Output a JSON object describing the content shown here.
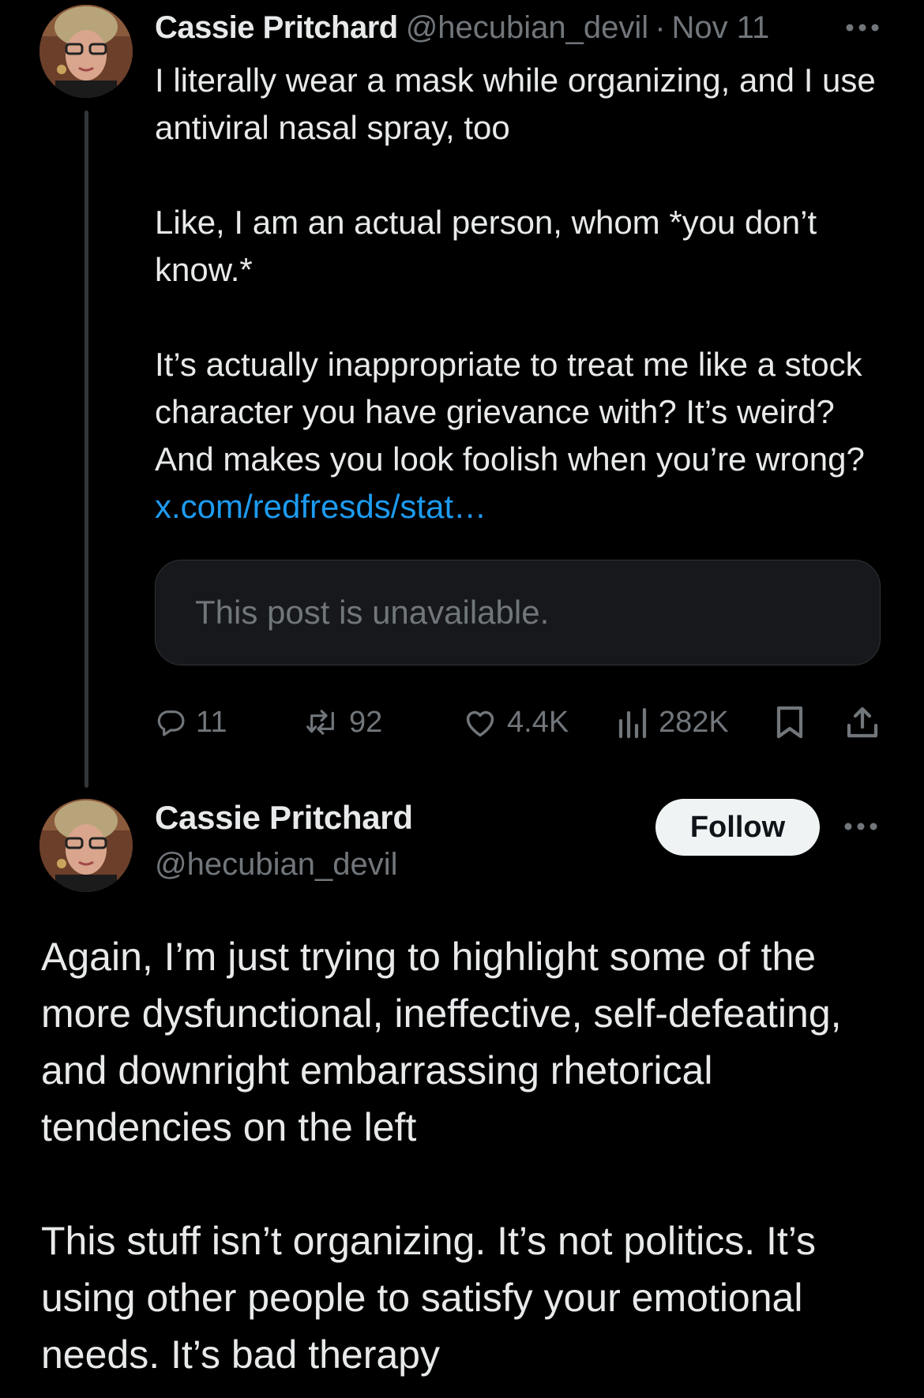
{
  "post1": {
    "author_name": "Cassie Pritchard",
    "author_handle": "@hecubian_devil",
    "separator": "·",
    "date": "Nov 11",
    "paragraphs": [
      "I literally wear a mask while organizing, and I use antiviral nasal spray, too",
      "Like, I am an actual person, whom *you don’t know.*",
      "It’s actually inappropriate to treat me like a stock character you have grievance with? It’s weird? And makes you look foolish when you’re wrong?"
    ],
    "link_text": "x.com/redfresds/stat…",
    "quoted_post": "This post is unavailable.",
    "stats": {
      "replies": "11",
      "reposts": "92",
      "likes": "4.4K",
      "views": "282K"
    },
    "icons": [
      "more-icon",
      "reply-icon",
      "repost-icon",
      "like-icon",
      "views-icon",
      "bookmark-icon",
      "share-icon"
    ]
  },
  "post2": {
    "author_name": "Cassie Pritchard",
    "author_handle": "@hecubian_devil",
    "follow_label": "Follow",
    "paragraphs": [
      "Again, I’m just trying to highlight some of the more dysfunctional, ineffective, self-defeating, and downright embarrassing rhetorical tendencies on the left",
      "This stuff isn’t organizing. It’s not politics. It’s using other people to satisfy your emotional needs. It’s bad therapy"
    ]
  },
  "colors": {
    "background": "#000000",
    "text": "#e7e9ea",
    "secondary": "#71767b",
    "link": "#1d9bf0",
    "follow_bg": "#eff3f4"
  }
}
